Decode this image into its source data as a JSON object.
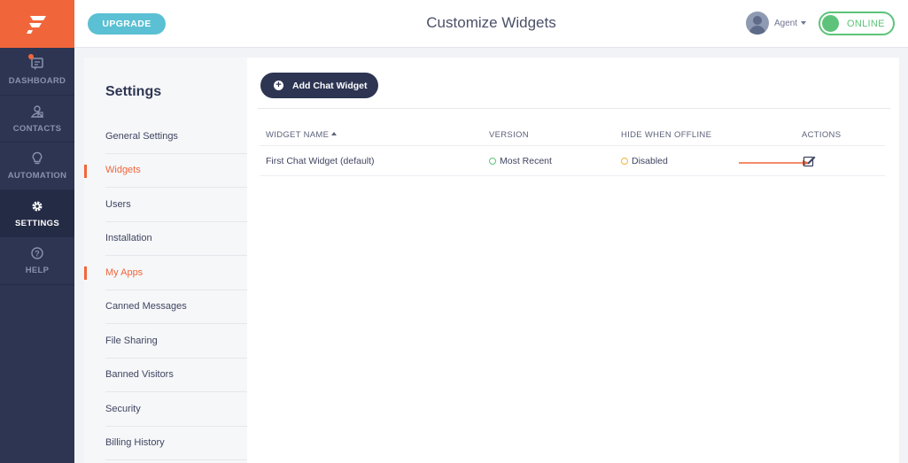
{
  "nav": {
    "items": [
      {
        "label": "DASHBOARD",
        "icon": "dashboard-icon"
      },
      {
        "label": "CONTACTS",
        "icon": "contacts-icon"
      },
      {
        "label": "AUTOMATION",
        "icon": "lightbulb-icon"
      },
      {
        "label": "SETTINGS",
        "icon": "gear-icon"
      },
      {
        "label": "HELP",
        "icon": "help-icon"
      }
    ],
    "active": "SETTINGS"
  },
  "topbar": {
    "upgrade_label": "UPGRADE",
    "title": "Customize Widgets",
    "agent_name": "Agent",
    "status_label": "ONLINE"
  },
  "settings": {
    "title": "Settings",
    "items": [
      {
        "label": "General Settings"
      },
      {
        "label": "Widgets"
      },
      {
        "label": "Users"
      },
      {
        "label": "Installation"
      },
      {
        "label": "My Apps"
      },
      {
        "label": "Canned Messages"
      },
      {
        "label": "File Sharing"
      },
      {
        "label": "Banned Visitors"
      },
      {
        "label": "Security"
      },
      {
        "label": "Billing History"
      }
    ],
    "highlighted": [
      "Widgets",
      "My Apps"
    ]
  },
  "main": {
    "add_button_label": "Add Chat Widget",
    "table": {
      "columns": [
        "WIDGET NAME",
        "VERSION",
        "HIDE WHEN OFFLINE",
        "ACTIONS"
      ],
      "rows": [
        {
          "name": "First Chat Widget (default)",
          "version": "Most Recent",
          "hide_when_offline": "Disabled",
          "action_icon": "edit-icon"
        }
      ]
    }
  },
  "colors": {
    "brand_orange": "#f0663a",
    "nav_dark": "#2d3553",
    "online_green": "#5dc37a",
    "upgrade_blue": "#5bc0d3",
    "disabled_orange": "#f2b63a"
  }
}
